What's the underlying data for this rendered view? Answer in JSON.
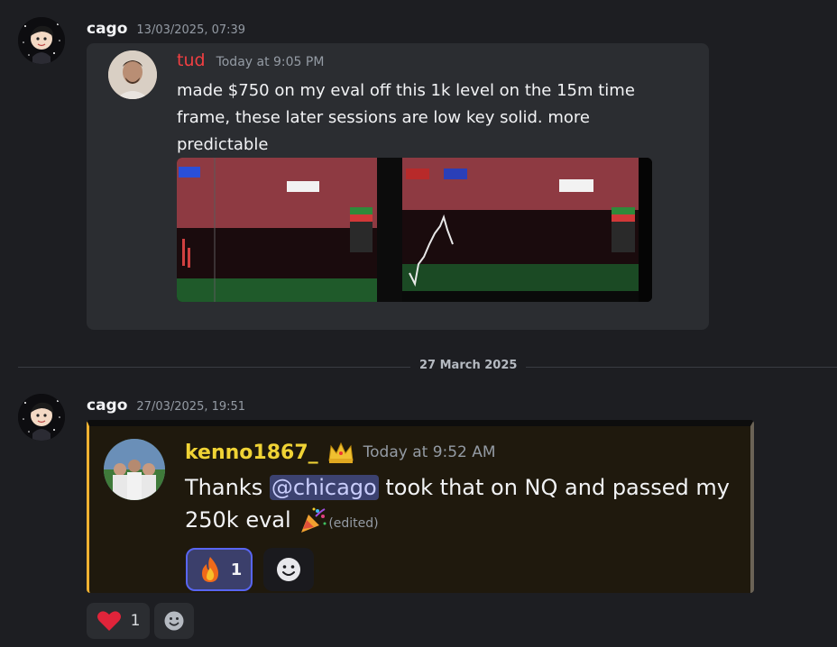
{
  "messages": [
    {
      "author": "cago",
      "timestamp": "13/03/2025, 07:39",
      "embed": {
        "author": "tud",
        "time": "Today at 9:05 PM",
        "text": "made $750 on my eval off this 1k level on the 15m time frame, these later sessions are low key solid. more predictable",
        "image": "trading-chart-screenshot"
      }
    },
    {
      "author": "cago",
      "timestamp": "27/03/2025, 19:51",
      "embed": {
        "author": "kenno1867_",
        "time": "Today at 9:52 AM",
        "text_before": "Thanks ",
        "mention": "@chicago",
        "text_after": " took that on NQ and passed my 250k eval",
        "edited": "(edited)",
        "reaction": {
          "emoji": "fire",
          "count": "1"
        }
      }
    }
  ],
  "divider": {
    "label": "27 March 2025"
  },
  "reactions": [
    {
      "emoji": "heart",
      "count": "1"
    }
  ],
  "colors": {
    "background": "#1d1e22",
    "embed1_bg": "#2b2d31",
    "embed2_bg": "#1f190d",
    "embed2_accent": "#f0b232",
    "tud_name": "#f23f42",
    "kenno_name": "#f0d335",
    "mention_bg": "#3c4270"
  },
  "icons": [
    "crown-icon",
    "party-popper-icon",
    "fire-icon",
    "heart-icon",
    "add-reaction-icon"
  ]
}
